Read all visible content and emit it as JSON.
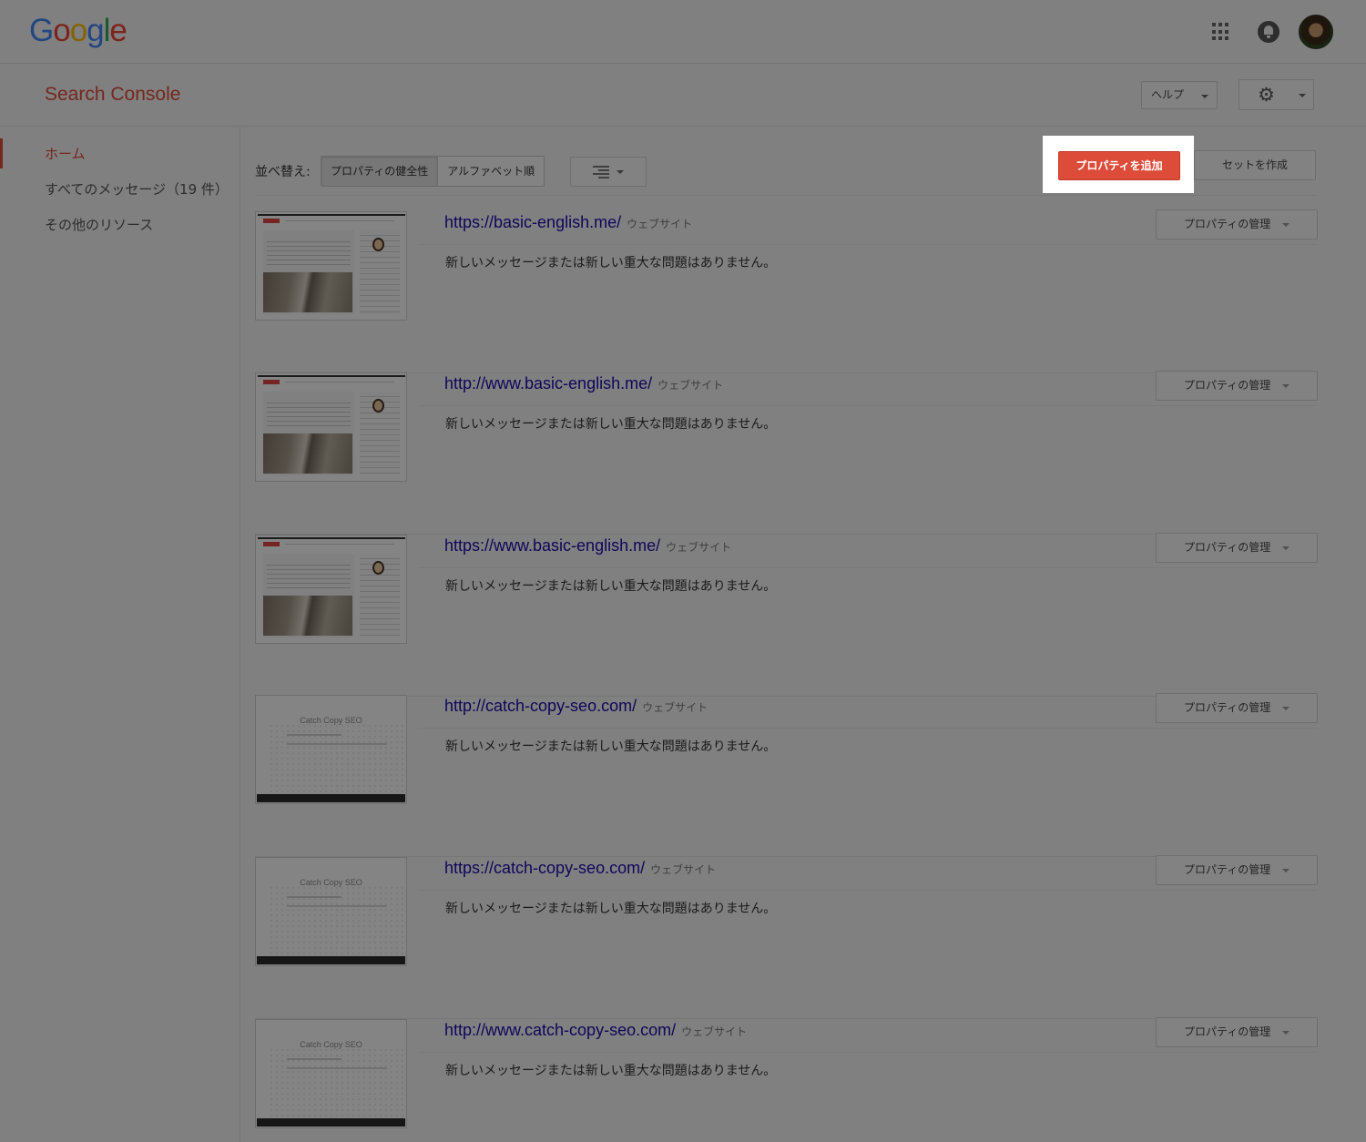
{
  "header": {
    "logo": [
      "G",
      "o",
      "o",
      "g",
      "l",
      "e"
    ],
    "icons": [
      "apps-icon",
      "notifications-icon",
      "avatar"
    ]
  },
  "subheader": {
    "title": "Search Console",
    "help_label": "ヘルプ",
    "settings_icon": "gear-icon"
  },
  "sidebar": {
    "items": [
      {
        "label": "ホーム",
        "active": true
      },
      {
        "label": "すべてのメッセージ（19 件）",
        "active": false
      },
      {
        "label": "その他のリソース",
        "active": false
      }
    ]
  },
  "toolbar": {
    "sort_label": "並べ替え:",
    "sort_options": [
      "プロパティの健全性",
      "アルファベット順"
    ],
    "sort_selected": "プロパティの健全性",
    "view_icon": "list-view-icon",
    "add_property_label": "プロパティを追加",
    "create_set_label": "セットを作成"
  },
  "properties": [
    {
      "url": "https://basic-english.me/",
      "type": "ウェブサイト",
      "message": "新しいメッセージまたは新しい重大な問題はありません。",
      "manage_label": "プロパティの管理",
      "thumb_title": ""
    },
    {
      "url": "http://www.basic-english.me/",
      "type": "ウェブサイト",
      "message": "新しいメッセージまたは新しい重大な問題はありません。",
      "manage_label": "プロパティの管理",
      "thumb_title": ""
    },
    {
      "url": "https://www.basic-english.me/",
      "type": "ウェブサイト",
      "message": "新しいメッセージまたは新しい重大な問題はありません。",
      "manage_label": "プロパティの管理",
      "thumb_title": ""
    },
    {
      "url": "http://catch-copy-seo.com/",
      "type": "ウェブサイト",
      "message": "新しいメッセージまたは新しい重大な問題はありません。",
      "manage_label": "プロパティの管理",
      "thumb_title": "Catch Copy SEO"
    },
    {
      "url": "https://catch-copy-seo.com/",
      "type": "ウェブサイト",
      "message": "新しいメッセージまたは新しい重大な問題はありません。",
      "manage_label": "プロパティの管理",
      "thumb_title": "Catch Copy SEO"
    },
    {
      "url": "http://www.catch-copy-seo.com/",
      "type": "ウェブサイト",
      "message": "新しいメッセージまたは新しい重大な問題はありません。",
      "manage_label": "プロパティの管理",
      "thumb_title": "Catch Copy SEO"
    }
  ],
  "colors": {
    "brand_red": "#dd4b39",
    "link_blue": "#1a0dab",
    "overlay": "rgba(0,0,0,0.47)"
  }
}
